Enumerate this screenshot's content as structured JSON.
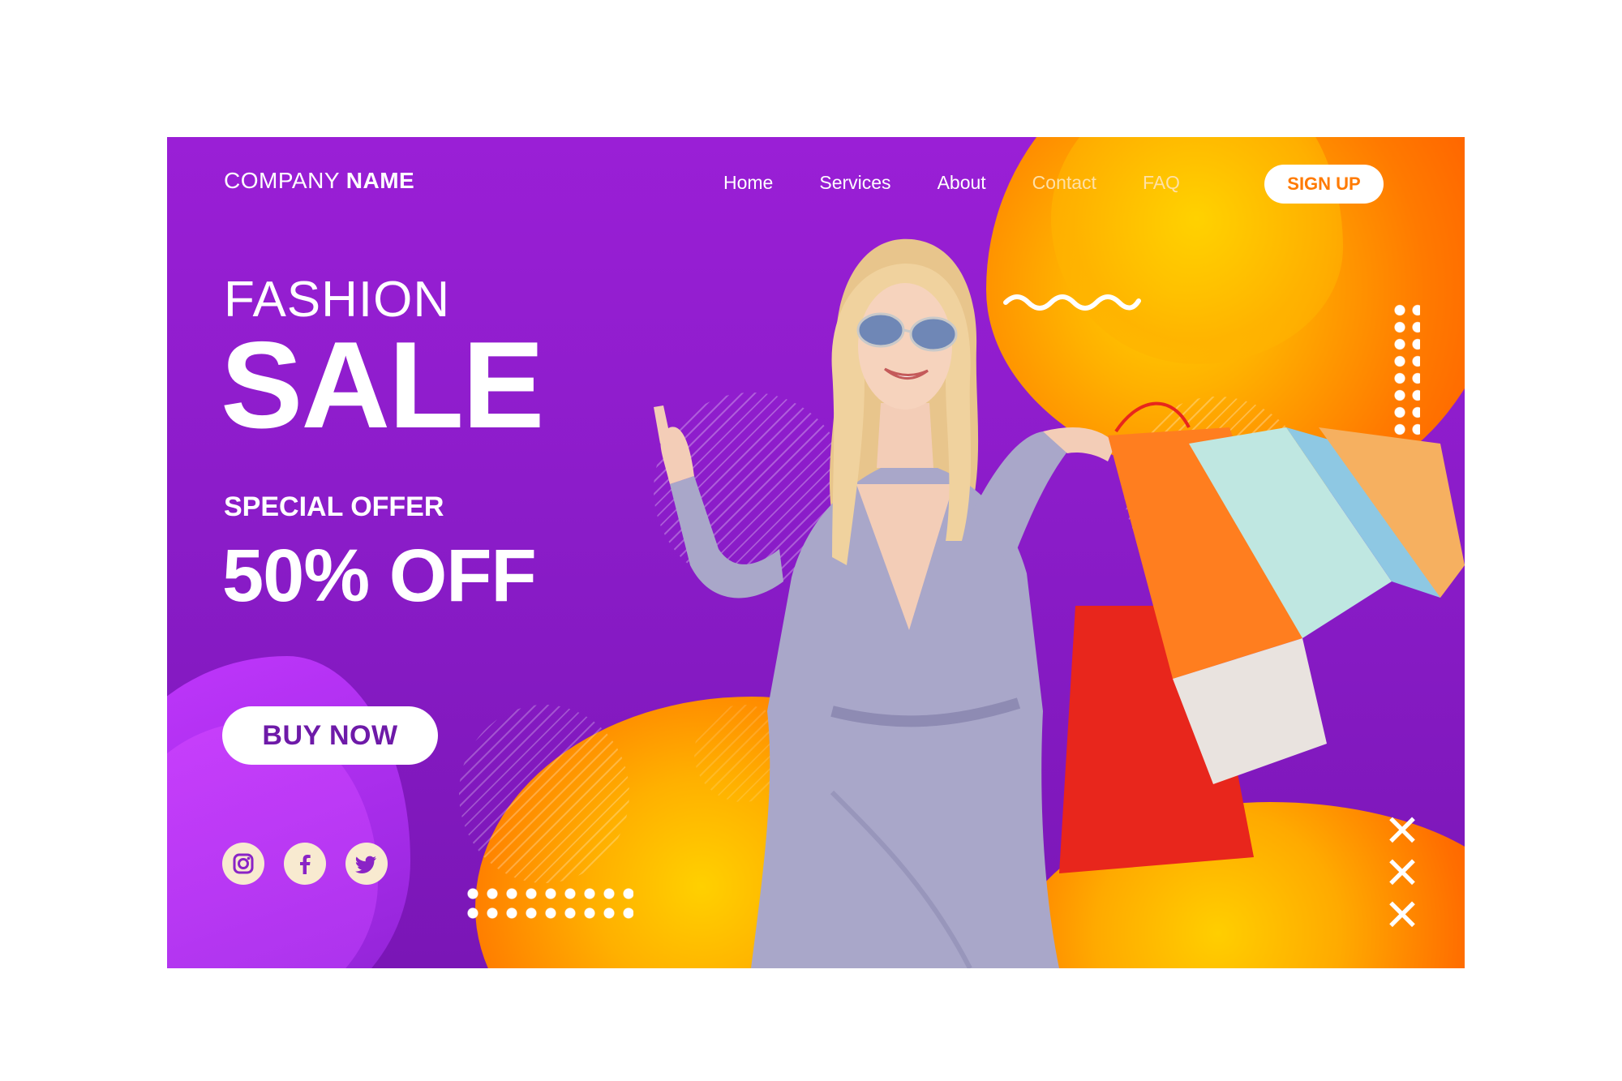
{
  "header": {
    "brand_regular": "COMPANY",
    "brand_bold": "NAME",
    "nav": [
      "Home",
      "Services",
      "About",
      "Contact",
      "FAQ"
    ],
    "signup_label": "SIGN UP"
  },
  "hero": {
    "title_line1": "FASHION",
    "title_line2": "SALE",
    "offer_label": "SPECIAL OFFER",
    "offer_value": "50% OFF",
    "cta_label": "BUY NOW"
  },
  "socials": [
    "instagram-icon",
    "facebook-icon",
    "twitter-icon"
  ],
  "decor": {
    "crosses": [
      "✕",
      "✕",
      "✕"
    ]
  },
  "colors": {
    "background_purple": "#9a1fd6",
    "accent_orange": "#ff7a00",
    "accent_yellow": "#ffce00",
    "button_text_purple": "#6e1aa8",
    "white": "#ffffff"
  }
}
